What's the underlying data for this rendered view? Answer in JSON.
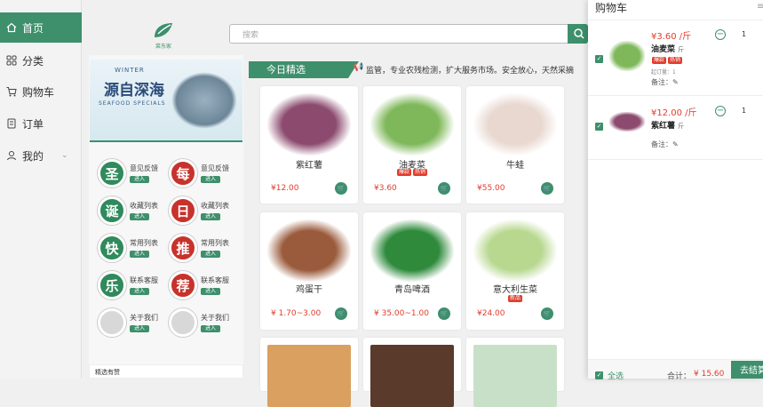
{
  "nav": {
    "home": "首页",
    "category": "分类",
    "cart": "购物车",
    "orders": "订单",
    "mine": "我的"
  },
  "header": {
    "logo_text": "菜东家",
    "search_placeholder": "搜索"
  },
  "banner": {
    "line1": "WINTER",
    "line2": "源自深海",
    "line3": "SEAFOOD SPECIALS"
  },
  "favorites": [
    {
      "char": "圣",
      "label": "意见反馈",
      "btn": "进入",
      "color": "#2f8a5c"
    },
    {
      "char": "每",
      "label": "意见反馈",
      "btn": "进入",
      "color": "#c8322c"
    },
    {
      "char": "诞",
      "label": "收藏列表",
      "btn": "进入",
      "color": "#2f8a5c"
    },
    {
      "char": "日",
      "label": "收藏列表",
      "btn": "进入",
      "color": "#c8322c"
    },
    {
      "char": "快",
      "label": "常用列表",
      "btn": "进入",
      "color": "#2f8a5c"
    },
    {
      "char": "推",
      "label": "常用列表",
      "btn": "进入",
      "color": "#c8322c"
    },
    {
      "char": "乐",
      "label": "联系客服",
      "btn": "进入",
      "color": "#2f8a5c"
    },
    {
      "char": "荐",
      "label": "联系客服",
      "btn": "进入",
      "color": "#c8322c"
    },
    {
      "char": "",
      "label": "关于我们",
      "btn": "进入",
      "color": "#d8d8d8"
    },
    {
      "char": "",
      "label": "关于我们",
      "btn": "进入",
      "color": "#d8d8d8"
    }
  ],
  "section": {
    "today_title": "今日精选",
    "marquee": "监管，专业农残检测，扩大服务市场。安全放心，天然采摘",
    "bottom_title": "精选有赞"
  },
  "products": [
    {
      "name": "紫红薯",
      "price": "¥12.00",
      "tags": [],
      "img_color": "#8b4a6e"
    },
    {
      "name": "油麦菜",
      "price": "¥3.60",
      "tags": [
        "爆款",
        "热销"
      ],
      "img_color": "#7fb85a"
    },
    {
      "name": "牛蛙",
      "price": "¥55.00",
      "tags": [],
      "img_color": "#e8d8d0"
    },
    {
      "name": "鸡蛋干",
      "price": "¥ 1.70~3.00",
      "tags": [],
      "img_color": "#9a5a3c"
    },
    {
      "name": "青岛啤酒",
      "price": "¥ 35.00~1.00",
      "tags": [],
      "img_color": "#2f8a3c"
    },
    {
      "name": "意大利生菜",
      "price": "¥24.00",
      "tags": [
        "新品"
      ],
      "img_color": "#b8d890"
    }
  ],
  "cart": {
    "title": "购物车",
    "items": [
      {
        "price": "¥3.60 /斤",
        "name": "油麦菜",
        "unit": "斤",
        "tags": [
          "爆款",
          "热销"
        ],
        "min_order": "起订量：1",
        "note": "备注：",
        "qty": "1",
        "img_color": "#7fb85a"
      },
      {
        "price": "¥12.00 /斤",
        "name": "紫红薯",
        "unit": "斤",
        "tags": [],
        "min_order": "",
        "note": "备注：",
        "qty": "1",
        "img_color": "#8b4a6e"
      }
    ],
    "select_all": "全选",
    "total_label": "合计：",
    "total": "¥ 15.60",
    "checkout": "去结算"
  },
  "colors": {
    "accent": "#3e8f6c",
    "price": "#e23c2c"
  }
}
